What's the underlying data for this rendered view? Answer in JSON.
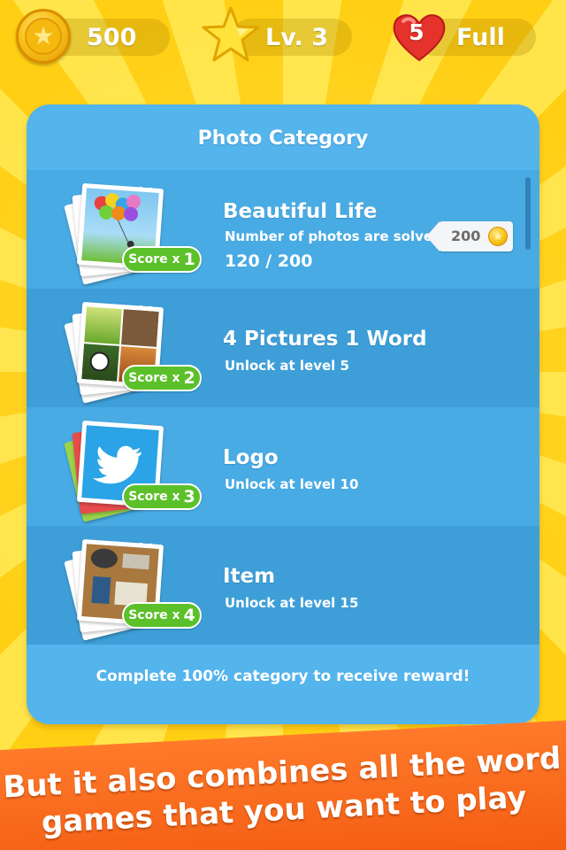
{
  "hud": {
    "coins": "500",
    "level": "Lv. 3",
    "lives_count": "5",
    "lives_status": "Full"
  },
  "panel": {
    "title": "Photo Category",
    "footer": "Complete 100% category to receive reward!",
    "categories": [
      {
        "name": "Beautiful Life",
        "subtitle": "Number of photos are solved",
        "progress": "120 / 200",
        "reward": "200",
        "score_label": "Score x",
        "score_mult": "1",
        "icon": "balloons-photo-stack-icon"
      },
      {
        "name": "4 Pictures 1 Word",
        "subtitle": "Unlock at level 5",
        "score_label": "Score x",
        "score_mult": "2",
        "icon": "four-pictures-stack-icon"
      },
      {
        "name": "Logo",
        "subtitle": "Unlock at level 10",
        "score_label": "Score x",
        "score_mult": "3",
        "icon": "twitter-logo-stack-icon"
      },
      {
        "name": "Item",
        "subtitle": "Unlock at level 15",
        "score_label": "Score x",
        "score_mult": "4",
        "icon": "items-photo-stack-icon"
      }
    ]
  },
  "banner": {
    "line1": "But it also combines all the word",
    "line2": "games that you want to play"
  },
  "colors": {
    "background": "#ffd21a",
    "panel": "#54b4ec",
    "row_dark": "#3e9fd8",
    "score_badge": "#5cc02a",
    "banner": "#f25a10"
  }
}
